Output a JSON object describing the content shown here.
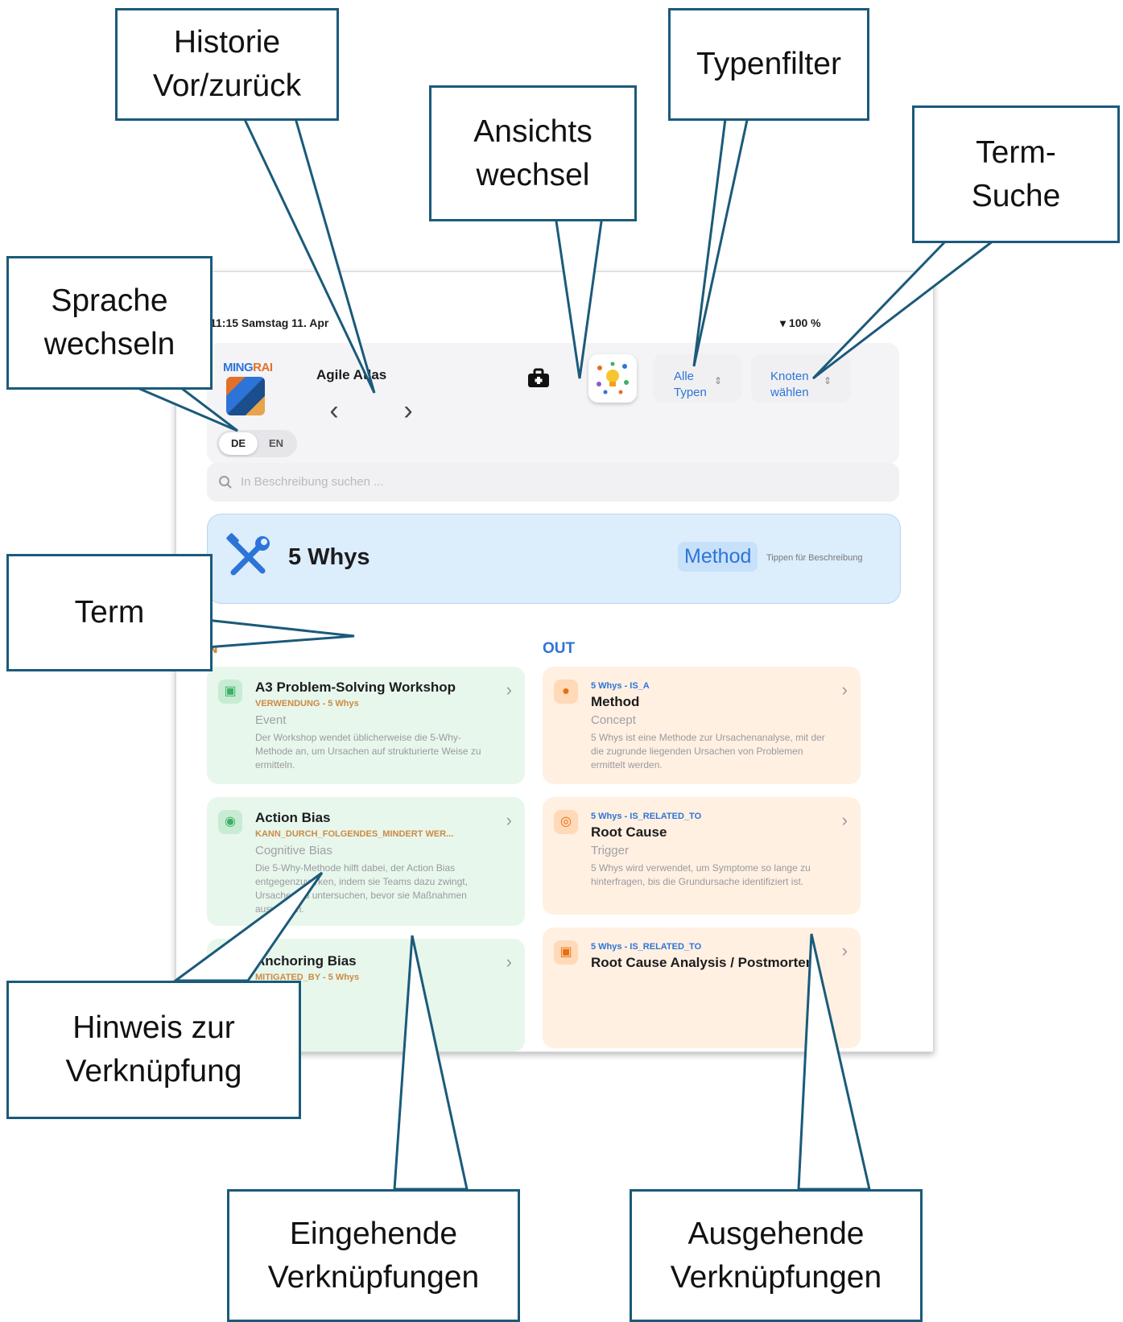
{
  "callouts": {
    "history": "Historie\nVor/zurück",
    "view_switch": "Ansichts\nwechsel",
    "type_filter": "Typenfilter",
    "term_search": "Term-\nSuche",
    "language": "Sprache\nwechseln",
    "term": "Term",
    "link_hint": "Hinweis zur\nVerknüpfung",
    "incoming": "Eingehende\nVerknüpfungen",
    "outgoing": "Ausgehende\nVerknüpfungen"
  },
  "status_bar": {
    "time_date": "11:15  Samstag 11. Apr",
    "battery": "100 %"
  },
  "header": {
    "logo_text_a": "MING",
    "logo_text_b": "RAI",
    "app_title": "Agile Atlas",
    "nav_back": "‹",
    "nav_forward": "›",
    "lang": {
      "de": "DE",
      "en": "EN"
    },
    "type_filter": "Alle\nTypen",
    "node_select": "Knoten\nwählen"
  },
  "search": {
    "placeholder": "In Beschreibung suchen ..."
  },
  "term": {
    "title": "5 Whys",
    "type": "Method",
    "hint": "Tippen für Beschreibung"
  },
  "columns": {
    "in_label": "N",
    "out_label": "OUT"
  },
  "incoming": [
    {
      "name": "A3 Problem-Solving Workshop",
      "relation": "VERWENDUNG - 5 Whys",
      "type": "Event",
      "description": "Der Workshop wendet üblicherweise die 5-Why-Methode an, um Ursachen auf strukturierte Weise zu ermitteln."
    },
    {
      "name": "Action Bias",
      "relation": "KANN_DURCH_FOLGENDES_MINDERT WER...",
      "type": "Cognitive Bias",
      "description": "Die 5-Why-Methode hilft dabei, der Action Bias entgegenzuwirken, indem sie Teams dazu zwingt, Ursachen zu untersuchen, bevor sie Maßnahmen auswählen."
    },
    {
      "name": "Anchoring Bias",
      "relation": "MITIGATED_BY - 5 Whys"
    }
  ],
  "outgoing": [
    {
      "relation": "5 Whys - IS_A",
      "name": "Method",
      "type": "Concept",
      "description": "5 Whys ist eine Methode zur Ursachenanalyse, mit der die zugrunde liegenden Ursachen von Problemen ermittelt werden."
    },
    {
      "relation": "5 Whys - IS_RELATED_TO",
      "name": "Root Cause",
      "type": "Trigger",
      "description": "5 Whys wird verwendet, um Symptome so lange zu hinterfragen, bis die Grundursache identifiziert ist."
    },
    {
      "relation": "5 Whys - IS_RELATED_TO",
      "name": "Root Cause Analysis / Postmortem"
    }
  ],
  "icons": {
    "toolbox": "toolbox-icon",
    "lightbulb": "lightbulb-graph-icon",
    "search": "search-icon",
    "term": "wrench-screwdriver-icon"
  },
  "colors": {
    "accent": "#2d74d8",
    "callout_border": "#1b5a7a",
    "incoming_card": "#e7f7ec",
    "outgoing_card": "#fff0e2",
    "term_card": "#dcedfc"
  }
}
